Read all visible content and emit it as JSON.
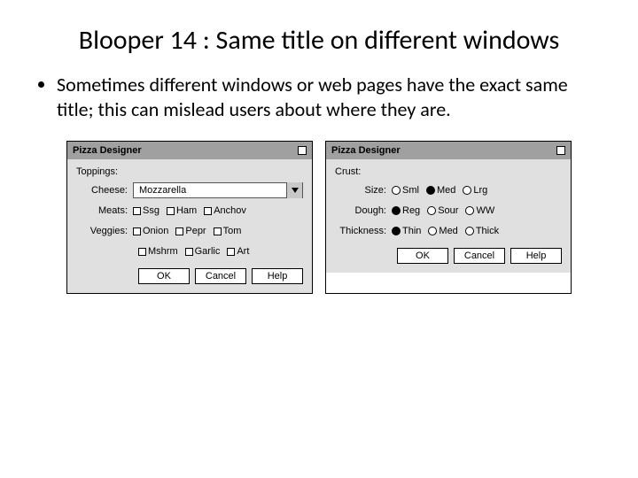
{
  "title": "Blooper 14 : Same title on different windows",
  "bullet": "Sometimes different windows or web pages have the exact same title; this can mislead users about where they are.",
  "windowLeft": {
    "title": "Pizza Designer",
    "section": "Toppings:",
    "cheeseLabel": "Cheese:",
    "cheeseValue": "Mozzarella",
    "meatsLabel": "Meats:",
    "meats": [
      "Ssg",
      "Ham",
      "Anchov"
    ],
    "veggiesLabel": "Veggies:",
    "veggies1": [
      "Onion",
      "Pepr",
      "Tom"
    ],
    "veggies2": [
      "Mshrm",
      "Garlic",
      "Art"
    ],
    "buttons": {
      "ok": "OK",
      "cancel": "Cancel",
      "help": "Help"
    }
  },
  "windowRight": {
    "title": "Pizza Designer",
    "section": "Crust:",
    "rows": [
      {
        "label": "Size:",
        "opts": [
          {
            "t": "Sml",
            "on": false
          },
          {
            "t": "Med",
            "on": true
          },
          {
            "t": "Lrg",
            "on": false
          }
        ]
      },
      {
        "label": "Dough:",
        "opts": [
          {
            "t": "Reg",
            "on": true
          },
          {
            "t": "Sour",
            "on": false
          },
          {
            "t": "WW",
            "on": false
          }
        ]
      },
      {
        "label": "Thickness:",
        "opts": [
          {
            "t": "Thin",
            "on": true
          },
          {
            "t": "Med",
            "on": false
          },
          {
            "t": "Thick",
            "on": false
          }
        ]
      }
    ],
    "buttons": {
      "ok": "OK",
      "cancel": "Cancel",
      "help": "Help"
    }
  }
}
